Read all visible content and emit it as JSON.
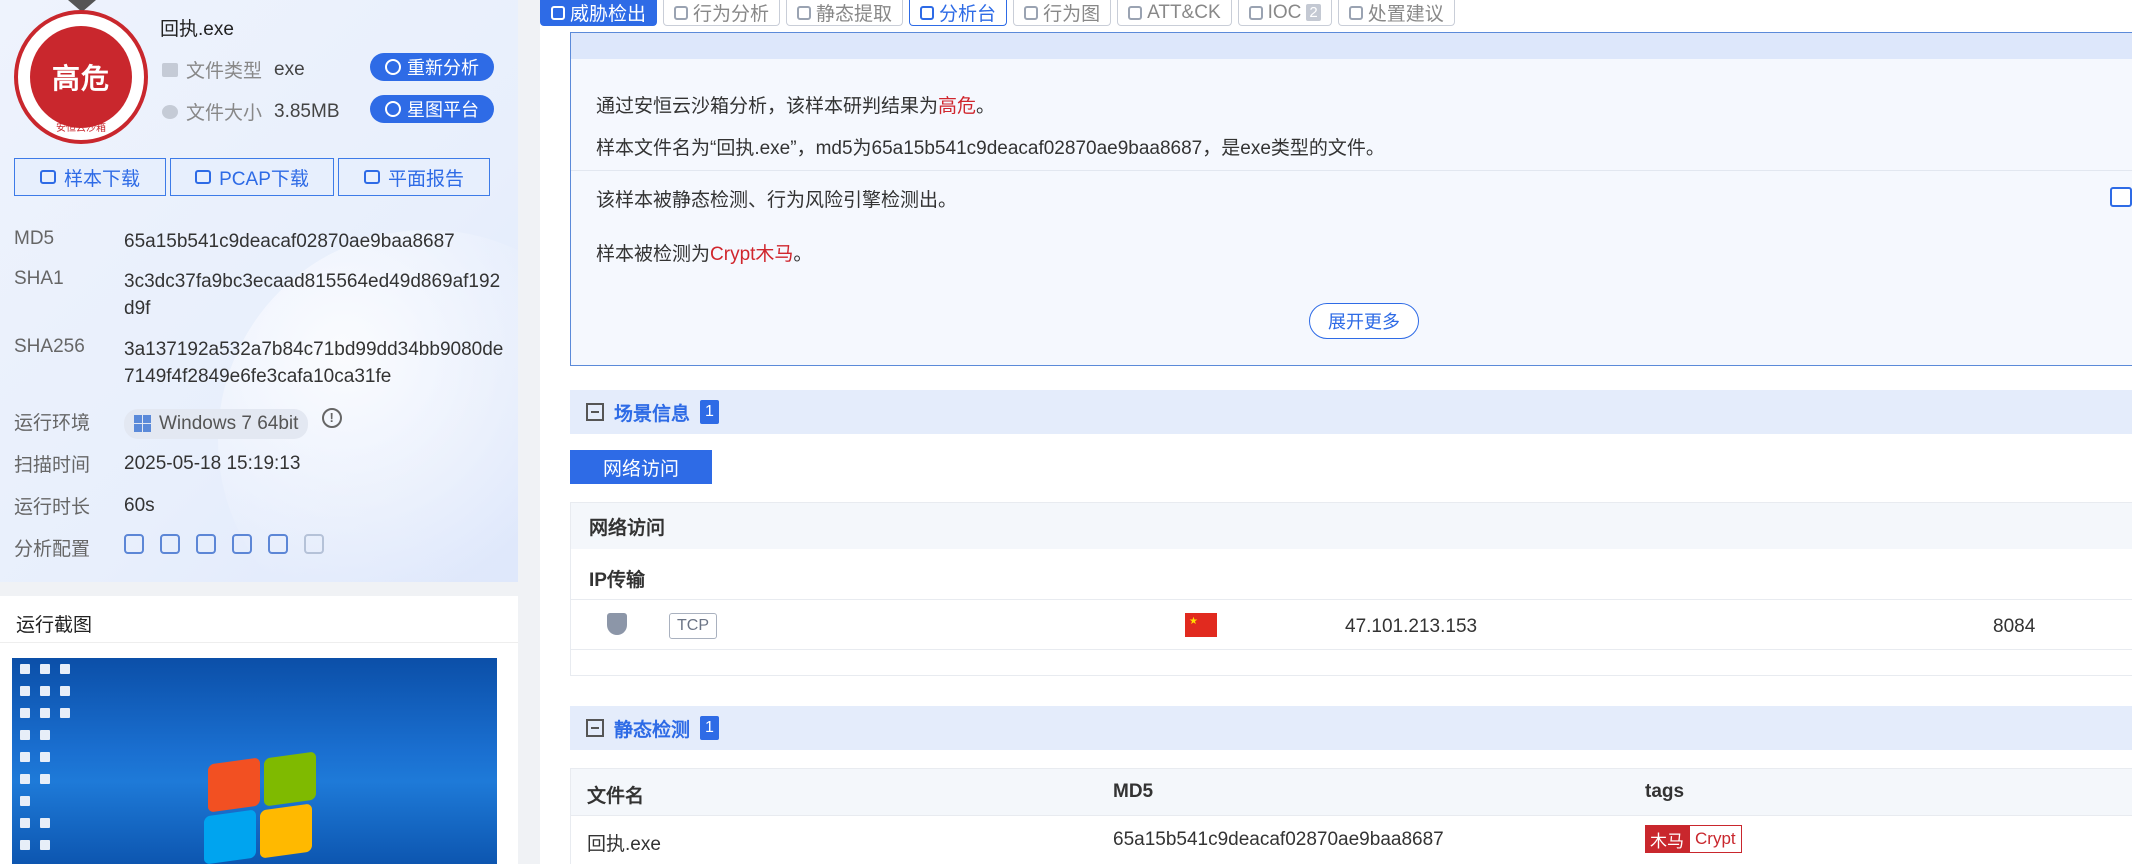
{
  "sample": {
    "file_name": "回执.exe",
    "risk_label": "高危",
    "seal_text": "安恒云沙箱",
    "file_type_label": "文件类型",
    "file_type": "exe",
    "file_size_label": "文件大小",
    "file_size": "3.85MB",
    "reanalyze_button": "重新分析",
    "star_platform_button": "星图平台"
  },
  "downloads": {
    "sample": "样本下载",
    "pcap": "PCAP下载",
    "report": "平面报告"
  },
  "details": {
    "md5_label": "MD5",
    "md5": "65a15b541c9deacaf02870ae9baa8687",
    "sha1_label": "SHA1",
    "sha1": "3c3dc37fa9bc3ecaad815564ed49d869af192d9f",
    "sha256_label": "SHA256",
    "sha256": "3a137192a532a7b84c71bd99dd34bb9080de7149f4f2849e6fe3cafa10ca31fe",
    "env_label": "运行环境",
    "env": "Windows 7 64bit",
    "scan_time_label": "扫描时间",
    "scan_time": "2025-05-18 15:19:13",
    "duration_label": "运行时长",
    "duration": "60s",
    "config_label": "分析配置"
  },
  "screenshot_panel": {
    "title": "运行截图"
  },
  "tabs": [
    {
      "label": "威胁检出",
      "state": "active",
      "icon": "alert-icon"
    },
    {
      "label": "行为分析",
      "state": "normal",
      "icon": "behavior-icon"
    },
    {
      "label": "静态提取",
      "state": "normal",
      "icon": "document-icon"
    },
    {
      "label": "分析台",
      "state": "outlined",
      "icon": "monitor-icon"
    },
    {
      "label": "行为图",
      "state": "normal",
      "icon": "graph-icon"
    },
    {
      "label": "ATT&CK",
      "state": "normal",
      "icon": "attck-icon"
    },
    {
      "label": "IOC",
      "state": "normal",
      "icon": "ioc-icon",
      "count": "2"
    },
    {
      "label": "处置建议",
      "state": "normal",
      "icon": "suggestion-icon"
    }
  ],
  "summary": {
    "line1_prefix": "通过安恒云沙箱分析，该样本研判结果为",
    "line1_verdict": "高危",
    "line1_suffix": "。",
    "line2": "样本文件名为“回执.exe”，md5为65a15b541c9deacaf02870ae9baa8687，是exe类型的文件。",
    "line3": "该样本被静态检测、行为风险引擎检测出。",
    "line4_prefix": "样本被检测为",
    "line4_name": "Crypt木马",
    "line4_suffix": "。",
    "expand_button": "展开更多"
  },
  "scene_section": {
    "title": "场景信息",
    "count": "1",
    "tab_label": "网络访问",
    "table_header": "网络访问",
    "sub_header": "IP传输",
    "row": {
      "protocol": "TCP",
      "country_flag": "cn-flag",
      "ip": "47.101.213.153",
      "port": "8084"
    }
  },
  "static_section": {
    "title": "静态检测",
    "count": "1",
    "columns": [
      "文件名",
      "MD5",
      "tags"
    ],
    "row": {
      "file_name": "回执.exe",
      "md5": "65a15b541c9deacaf02870ae9baa8687",
      "tag_type": "木马",
      "tag_family": "Crypt"
    }
  },
  "colors": {
    "accent": "#2e6be6",
    "danger": "#c9272d",
    "panel_bg": "#eef3fd"
  }
}
